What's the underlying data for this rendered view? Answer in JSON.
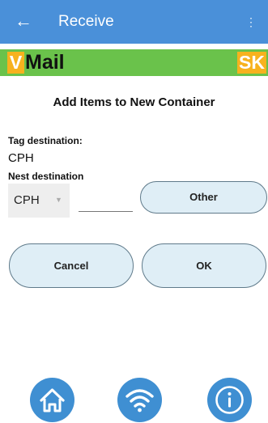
{
  "appbar": {
    "back_glyph": "←",
    "title": "Receive",
    "menu_glyph": "⋮"
  },
  "brand": {
    "v": "V",
    "mail": "Mail",
    "sk": "SK",
    "colors": {
      "bar": "#6ac24b",
      "badge": "#f7b21e"
    }
  },
  "heading": "Add Items to New Container",
  "tag_destination": {
    "label": "Tag destination:",
    "value": "CPH"
  },
  "nest_destination": {
    "label": "Nest destination",
    "selected": "CPH",
    "input_value": ""
  },
  "buttons": {
    "other": "Other",
    "cancel": "Cancel",
    "ok": "OK"
  },
  "bottom_nav": [
    {
      "icon": "home-icon"
    },
    {
      "icon": "wifi-icon"
    },
    {
      "icon": "info-icon"
    }
  ],
  "colors": {
    "appbar": "#4a90d9",
    "pill_bg": "#dfeef6",
    "nav_button": "#3f8fd2"
  }
}
